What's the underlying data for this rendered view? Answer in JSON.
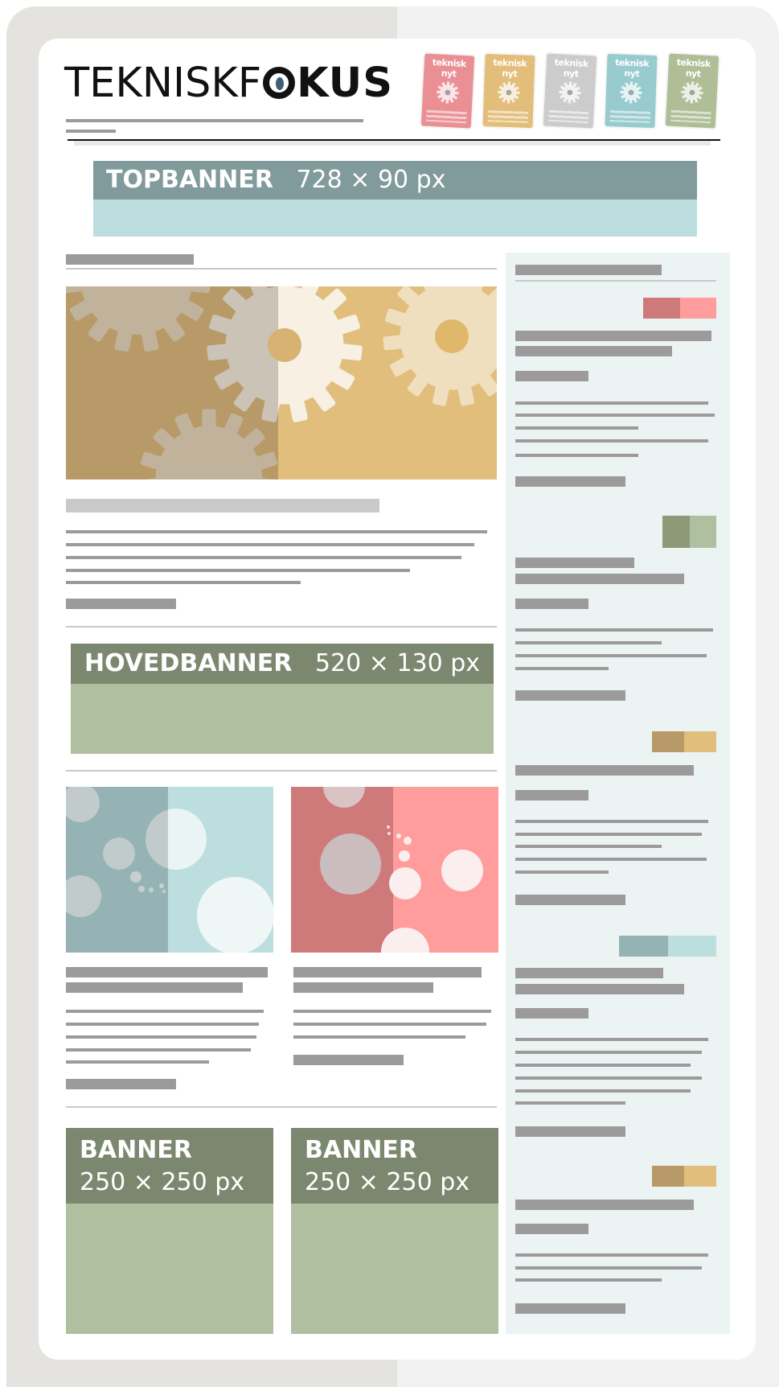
{
  "logo": {
    "part1": "TEKNISKF",
    "part_o": "",
    "part2": "KUS"
  },
  "magazines": [
    {
      "name": "teknisk nyt",
      "color": "#e8848a"
    },
    {
      "name": "teknisk nyt",
      "color": "#e0b86c"
    },
    {
      "name": "teknisk nyt",
      "color": "#c7c7c7"
    },
    {
      "name": "teknisk nyt",
      "color": "#8cc6c8"
    },
    {
      "name": "teknisk nyt",
      "color": "#a8b88c"
    }
  ],
  "top_banner": {
    "title": "TOPBANNER",
    "size": "728 × 90 px"
  },
  "main_banner": {
    "title": "HOVEDBANNER",
    "size": "520 × 130 px"
  },
  "square_banners": [
    {
      "title": "BANNER",
      "size": "250 × 250 px"
    },
    {
      "title": "BANNER",
      "size": "250 × 250 px"
    }
  ],
  "colors": {
    "frame_left": "#e5e3e0",
    "frame_right": "#f2f2f2",
    "text_placeholder": "#9c9a9a",
    "topbanner_dark": "#819b9c",
    "topbanner_light": "#bcdedf",
    "banner_dark": "#7c8770",
    "banner_light": "#b0bfa0",
    "sidebar_bg": "#ecf4f3",
    "tag_red": [
      "#cf7a7a",
      "#ff9c9c"
    ],
    "tag_green": [
      "#8c9a7a",
      "#afc0a0"
    ],
    "tag_gold": [
      "#b89a68",
      "#e2be7c"
    ],
    "tag_teal": [
      "#95b3b4",
      "#bcdedf"
    ]
  }
}
